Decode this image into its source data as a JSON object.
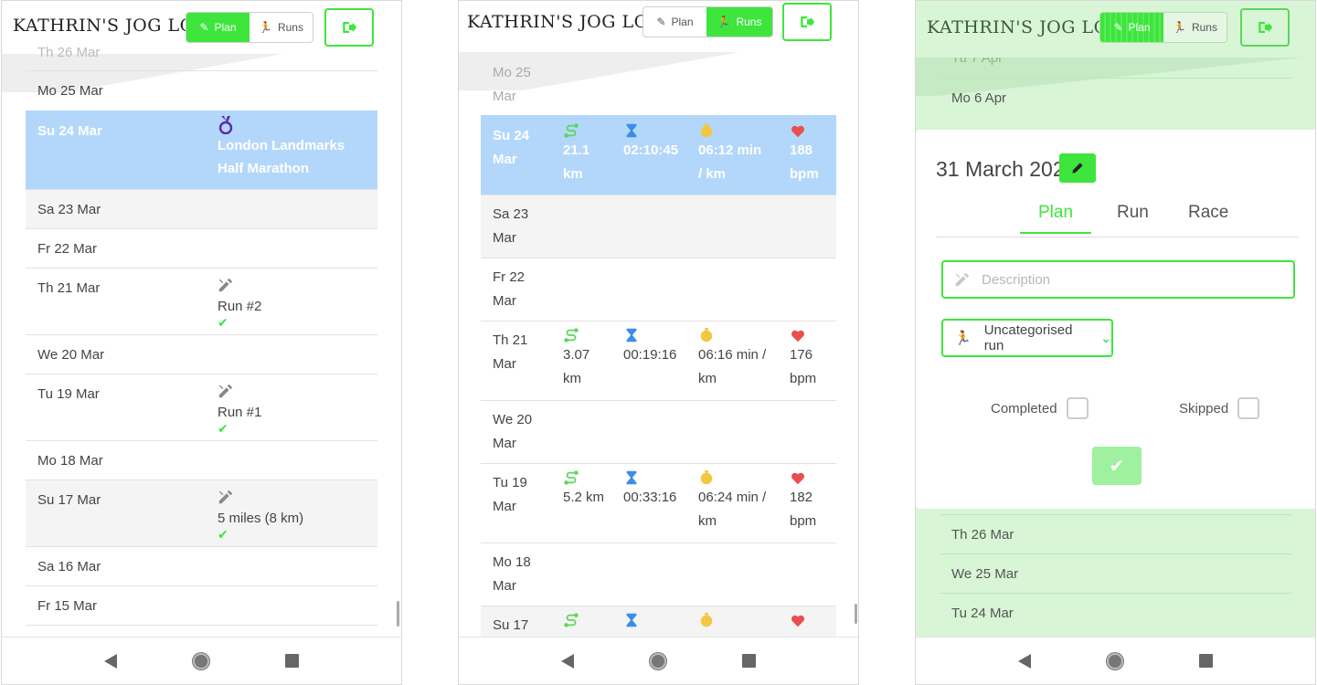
{
  "app": {
    "title": "KATHRIN'S JOG LOG"
  },
  "nav": {
    "plan_label": "Plan",
    "runs_label": "Runs"
  },
  "plan_screen": {
    "rows": [
      {
        "day": "Mo 25 Mar",
        "entry": "",
        "check": false
      },
      {
        "day": "Su 24 Mar",
        "entry": "London Landmarks Half Marathon",
        "check": false,
        "today": true,
        "icon": "medal-icon"
      },
      {
        "day": "Sa 23 Mar",
        "entry": "",
        "check": false
      },
      {
        "day": "Fr 22 Mar",
        "entry": "",
        "check": false
      },
      {
        "day": "Th 21 Mar",
        "entry": "Run #2",
        "check": true,
        "icon": "tools-icon"
      },
      {
        "day": "We 20 Mar",
        "entry": "",
        "check": false
      },
      {
        "day": "Tu 19 Mar",
        "entry": "Run #1",
        "check": true,
        "icon": "tools-icon"
      },
      {
        "day": "Mo 18 Mar",
        "entry": "",
        "check": false
      },
      {
        "day": "Su 17 Mar",
        "entry": "5 miles (8 km)",
        "check": true,
        "icon": "tools-icon"
      },
      {
        "day": "Sa 16 Mar",
        "entry": "",
        "check": false
      },
      {
        "day": "Fr 15 Mar",
        "entry": "",
        "check": false
      }
    ],
    "partial_top": "Th 26 Mar"
  },
  "runs_screen": {
    "rows": [
      {
        "day1": "Mo 25",
        "day2": "Mar"
      },
      {
        "day1": "Su 24",
        "day2": "Mar",
        "dist1": "21.1",
        "dist2": "km",
        "time": "02:10:45",
        "pace1": "06:12 min",
        "pace2": "/ km",
        "hr1": "188",
        "hr2": "bpm"
      },
      {
        "day1": "Sa 23",
        "day2": "Mar"
      },
      {
        "day1": "Fr 22",
        "day2": "Mar"
      },
      {
        "day1": "Th 21",
        "day2": "Mar",
        "dist1": "3.07",
        "dist2": "km",
        "time": "00:19:16",
        "pace1": "06:16 min /",
        "pace2": "km",
        "hr1": "176",
        "hr2": "bpm"
      },
      {
        "day1": "We 20",
        "day2": "Mar"
      },
      {
        "day1": "Tu 19",
        "day2": "Mar",
        "dist1": "5.2 km",
        "dist2": "",
        "time": "00:33:16",
        "pace1": "06:24 min /",
        "pace2": "km",
        "hr1": "182",
        "hr2": "bpm"
      },
      {
        "day1": "Mo 18",
        "day2": "Mar"
      },
      {
        "day1": "Su 17",
        "day2": ""
      }
    ]
  },
  "modal_screen": {
    "bg_top_rows": [
      "Tu 7 Apr",
      "Mo 6 Apr"
    ],
    "bg_bottom_rows": [
      "Th 26 Mar",
      "We 25 Mar",
      "Tu 24 Mar"
    ],
    "date": "31 March 2020",
    "tabs": [
      "Plan",
      "Run",
      "Race"
    ],
    "description_placeholder": "Description",
    "run_type": "Uncategorised run",
    "completed_label": "Completed",
    "skipped_label": "Skipped"
  },
  "colors": {
    "accent": "#3de53d",
    "today": "#b3d7fb",
    "modal_bg": "#d8f5d6"
  }
}
